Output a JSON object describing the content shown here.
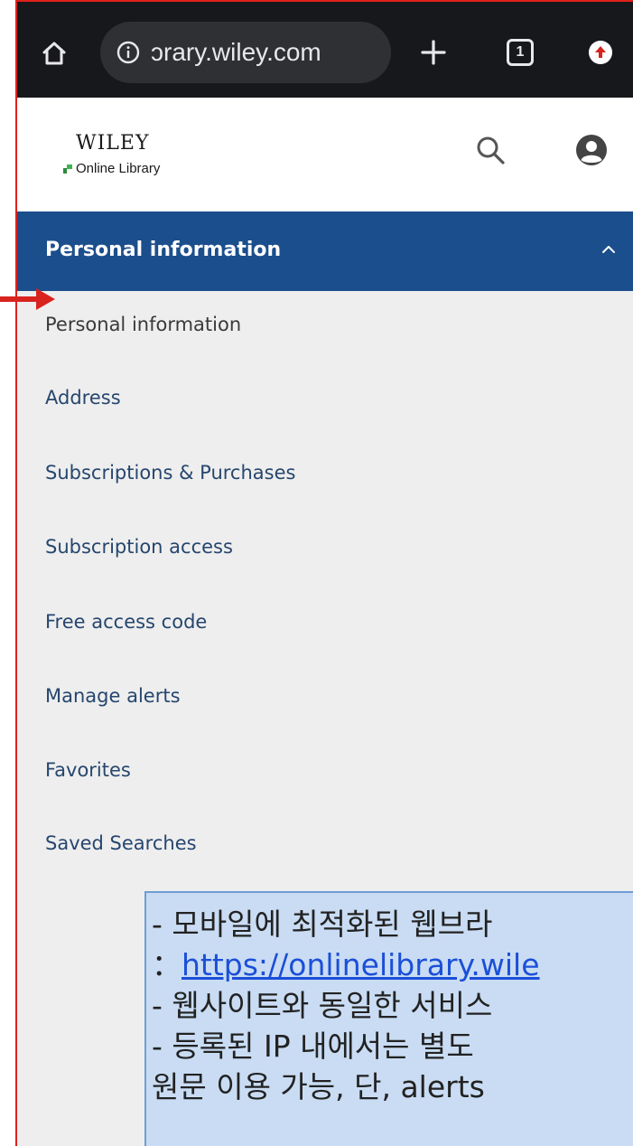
{
  "browser": {
    "url_text": "ɔrary.wiley.com",
    "tab_count": "1",
    "colors": {
      "bar": "#17181c",
      "pill": "#2e3034"
    },
    "icons": [
      "home-icon",
      "info-icon",
      "plus-icon",
      "tabs-icon",
      "extension-icon"
    ]
  },
  "header": {
    "logo_main": "WILEY",
    "logo_sub": "Online Library",
    "icons": [
      "search-icon",
      "account-icon"
    ]
  },
  "accordion": {
    "title": "Personal information",
    "color": "#1b4e8c",
    "icon": "chevron-up-icon"
  },
  "menu": {
    "items": [
      {
        "label": "Personal information",
        "active": true
      },
      {
        "label": "Address"
      },
      {
        "label": "Subscriptions & Purchases"
      },
      {
        "label": "Subscription access"
      },
      {
        "label": "Free access code"
      },
      {
        "label": "Manage alerts"
      },
      {
        "label": "Favorites"
      },
      {
        "label": "Saved Searches"
      }
    ]
  },
  "annotation": {
    "line1": "- 모바일에 최적화된 웹브라",
    "line2_prefix": "：",
    "line2_link": "https://onlinelibrary.wile",
    "line3": "- 웹사이트와 동일한 서비스",
    "line4": "- 등록된 IP 내에서는 별도",
    "line5": "원문 이용 가능, 단, alerts",
    "accent": "#e0201b"
  }
}
